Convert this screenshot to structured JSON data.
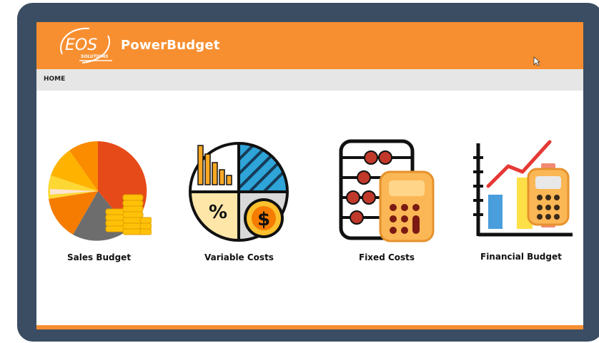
{
  "app": {
    "logo_text": "EOS",
    "logo_subtext": "SOLUTIONS",
    "title": "PowerBudget"
  },
  "breadcrumb": {
    "label": "HOME"
  },
  "tiles": [
    {
      "label": "Sales Budget",
      "icon": "pie-coins-icon"
    },
    {
      "label": "Variable Costs",
      "icon": "cost-quadrant-icon"
    },
    {
      "label": "Fixed Costs",
      "icon": "abacus-calculator-icon"
    },
    {
      "label": "Financial Budget",
      "icon": "growth-chart-calculator-icon"
    }
  ],
  "colors": {
    "brand": "#f78f31",
    "frame": "#3a4d62",
    "breadcrumb_bg": "#e6e6e6"
  }
}
